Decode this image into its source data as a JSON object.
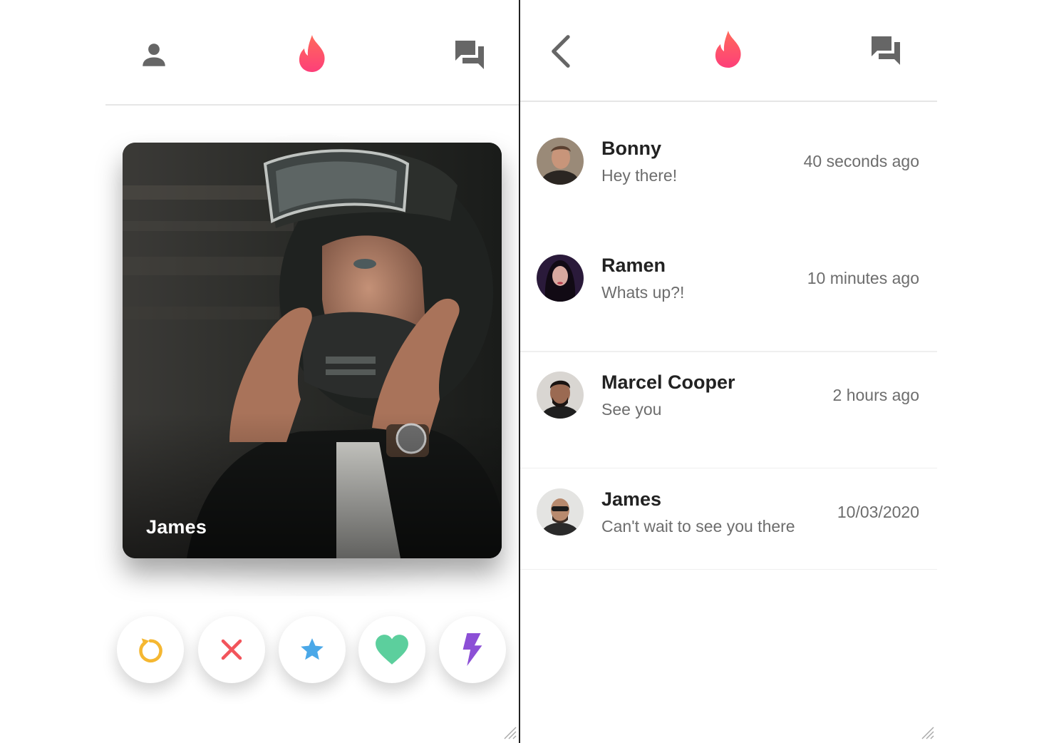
{
  "colors": {
    "brand": "#fd5068",
    "undo": "#f5b731",
    "nope": "#f2545b",
    "superlike": "#4aa8e8",
    "like": "#5ccf9d",
    "boost": "#8c4fd6",
    "icon_gray": "#666666"
  },
  "left_header": {
    "profile_icon": "person-icon",
    "brand_icon": "flame-icon",
    "chat_icon": "chat-icon"
  },
  "card": {
    "name": "James",
    "image": "man-in-motorcycle-helmet-photo"
  },
  "actions": [
    {
      "id": "undo",
      "icon": "undo-icon"
    },
    {
      "id": "nope",
      "icon": "close-icon"
    },
    {
      "id": "superlike",
      "icon": "star-icon"
    },
    {
      "id": "like",
      "icon": "heart-icon"
    },
    {
      "id": "boost",
      "icon": "lightning-icon"
    }
  ],
  "right_header": {
    "back_icon": "chevron-left-icon",
    "brand_icon": "flame-icon",
    "chat_icon": "chat-icon"
  },
  "messages": [
    {
      "name": "Bonny",
      "text": "Hey there!",
      "time": "40 seconds ago"
    },
    {
      "name": "Ramen",
      "text": "Whats up?!",
      "time": "10 minutes ago"
    },
    {
      "name": "Marcel Cooper",
      "text": "See you",
      "time": "2 hours ago"
    },
    {
      "name": "James",
      "text": "Can't wait to see you there",
      "time": "10/03/2020"
    }
  ]
}
